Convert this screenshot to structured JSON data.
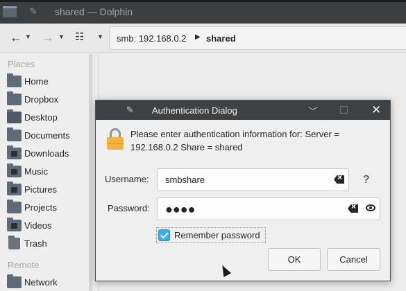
{
  "window": {
    "title": "shared — Dolphin"
  },
  "toolbar": {
    "location_host": "smb: 192.168.0.2",
    "location_folder": "shared"
  },
  "places": {
    "section_places": "Places",
    "items": [
      {
        "label": "Home",
        "icon": "home-folder-icon"
      },
      {
        "label": "Dropbox",
        "icon": "dropbox-folder-icon"
      },
      {
        "label": "Desktop",
        "icon": "desktop-icon"
      },
      {
        "label": "Documents",
        "icon": "documents-folder-icon"
      },
      {
        "label": "Downloads",
        "icon": "downloads-folder-icon"
      },
      {
        "label": "Music",
        "icon": "music-folder-icon"
      },
      {
        "label": "Pictures",
        "icon": "pictures-folder-icon"
      },
      {
        "label": "Projects",
        "icon": "projects-folder-icon"
      },
      {
        "label": "Videos",
        "icon": "videos-folder-icon"
      },
      {
        "label": "Trash",
        "icon": "trash-icon"
      }
    ],
    "section_remote": "Remote",
    "remote_items": [
      {
        "label": "Network",
        "icon": "network-folder-icon"
      }
    ]
  },
  "dialog": {
    "title": "Authentication Dialog",
    "message": "Please enter authentication information for: Server = 192.168.0.2 Share = shared",
    "username_label": "Username:",
    "username_value": "smbshare",
    "password_label": "Password:",
    "password_value": "●●●●",
    "help": "?",
    "remember_label": "Remember password",
    "remember_checked": true,
    "ok_label": "OK",
    "cancel_label": "Cancel"
  },
  "colors": {
    "accent": "#3daee9",
    "titlebar": "#3f4245",
    "lock": "#f2b240"
  }
}
